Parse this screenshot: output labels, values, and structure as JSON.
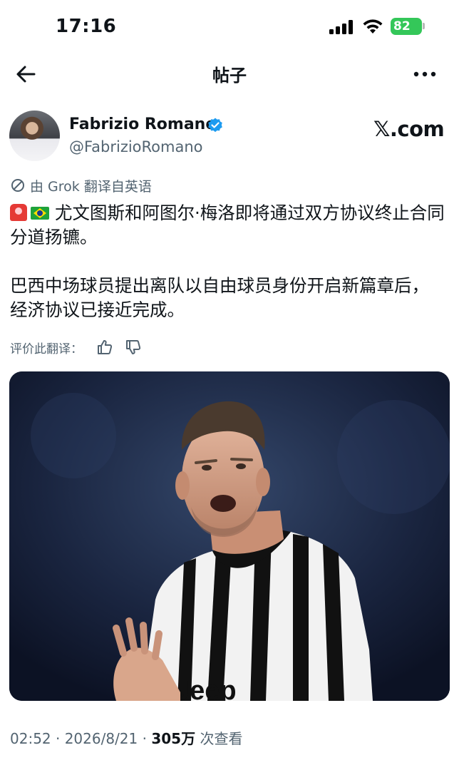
{
  "status_bar": {
    "time": "17:16",
    "battery": "82"
  },
  "nav": {
    "title": "帖子",
    "back_icon": "arrow-left-icon",
    "more_icon": "more-horizontal-icon"
  },
  "author": {
    "name": "Fabrizio Romano",
    "handle": "@FabrizioRomano",
    "verified": true,
    "verified_color": "#1d9bf0",
    "source": "𝕏.com"
  },
  "tweet": {
    "translated_label": "由 Grok 翻译自英语",
    "paragraph_1": "尤文图斯和阿图尔·梅洛即将通过双方协议终止合同分道扬镳。",
    "paragraph_2": "巴西中场球员提出离队以自由球员身份开启新篇章后，经济协议已接近完成。",
    "emoji_1": "siren-emoji",
    "emoji_2": "brazil-flag-emoji",
    "rate_label": "评价此翻译：",
    "rate_up_icon": "thumbs-up-icon",
    "rate_down_icon": "thumbs-down-icon"
  },
  "meta": {
    "time": "02:52 · 2026/8/21 · ",
    "views_count": "305万",
    "views_label": " 次查看"
  },
  "colors": {
    "accent": "#1d9bf0",
    "muted": "#536471",
    "battery": "#34c759"
  }
}
